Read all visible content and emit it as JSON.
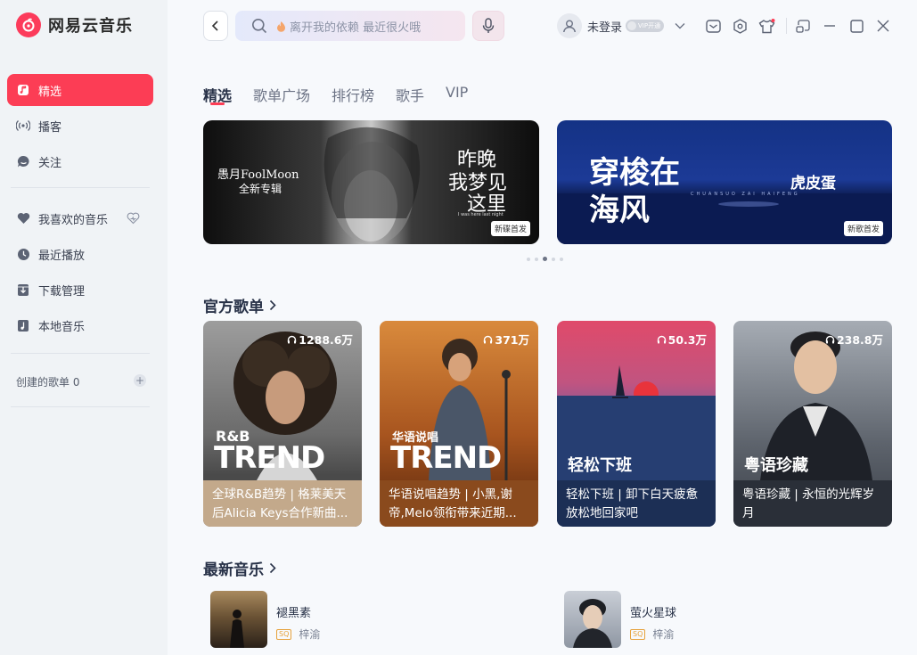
{
  "app": {
    "name": "网易云音乐"
  },
  "sidebar": {
    "items": [
      {
        "label": "精选",
        "icon": "music-note-icon",
        "active": true
      },
      {
        "label": "播客",
        "icon": "radio-icon"
      },
      {
        "label": "关注",
        "icon": "chat-bubble-icon"
      },
      {
        "label": "我喜欢的音乐",
        "icon": "heart-icon"
      },
      {
        "label": "最近播放",
        "icon": "clock-icon"
      },
      {
        "label": "下载管理",
        "icon": "download-icon"
      },
      {
        "label": "本地音乐",
        "icon": "local-music-icon"
      }
    ],
    "created_playlists": "创建的歌单 0",
    "add_label": "+"
  },
  "header": {
    "search_placeholder": "离开我的依赖 最近很火哦",
    "user_name": "未登录",
    "vip_label": "VIP开通"
  },
  "tabs": [
    "精选",
    "歌单广场",
    "排行榜",
    "歌手",
    "VIP"
  ],
  "banners": [
    {
      "title": "愚月FoolMoon",
      "subtitle": "全新专辑",
      "headline_line1": "昨晚",
      "headline_line2": "我梦见",
      "headline_line3": "这里",
      "caption": "I was here last night",
      "tag": "新碟首发"
    },
    {
      "title": "穿梭在海风",
      "artist": "虎皮蛋",
      "caption": "CHUANSUO ZAI HAIFENG",
      "tag": "新歌首发"
    }
  ],
  "sections": {
    "official_playlists": "官方歌单",
    "new_music": "最新音乐"
  },
  "playlists": [
    {
      "count": "1288.6万",
      "category_small": "R&B",
      "category_big": "TREND",
      "description": "全球R&B趋势 | 格莱美天后Alicia Keys合作新曲...",
      "bg_color": "#c3a98b"
    },
    {
      "count": "371万",
      "category_small": "华语说唱",
      "category_big": "TREND",
      "description": "华语说唱趋势 | 小黑,谢帝,Melo领衔带来近期...",
      "bg_color": "#8a4a1d"
    },
    {
      "count": "50.3万",
      "category": "轻松下班",
      "description": "轻松下班 | 卸下白天疲惫 放松地回家吧",
      "bg_color": "#1c2f55"
    },
    {
      "count": "238.8万",
      "category": "粤语珍藏",
      "description": "粤语珍藏 | 永恒的光辉岁月",
      "bg_color": "#2a2f38"
    }
  ],
  "songs": [
    {
      "title": "褪黑素",
      "quality": "SQ",
      "artist": "梓渝"
    },
    {
      "title": "萤火星球",
      "quality": "SQ",
      "artist": "梓渝"
    }
  ],
  "colors": {
    "accent": "#fc3d55",
    "sidebar_bg": "#f0f3f6",
    "page_bg": "#f7f9fc"
  }
}
